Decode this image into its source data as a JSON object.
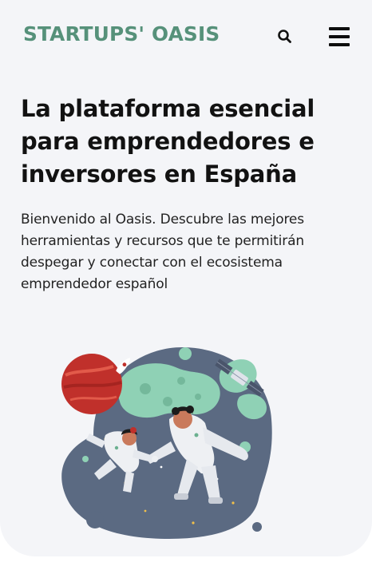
{
  "header": {
    "logo_text": "STARTUPS' OASIS",
    "logo_color": "#56917a",
    "search_icon": "search-icon",
    "menu_icon": "hamburger-menu-icon"
  },
  "hero": {
    "title": "La plataforma esencial para emprendedores e inversores en España",
    "description": "Bienvenido al Oasis. Descubre las mejores herramientas y recursos que te permitirán despegar y conectar con el ecosistema emprendedor español"
  },
  "illustration": {
    "subject": "astronauts-floating-in-space-illustration"
  },
  "colors": {
    "background": "#f4f5f8",
    "text": "#121212",
    "accent": "#56917a",
    "planet": "#c0302b",
    "space": "#5b6a82"
  }
}
